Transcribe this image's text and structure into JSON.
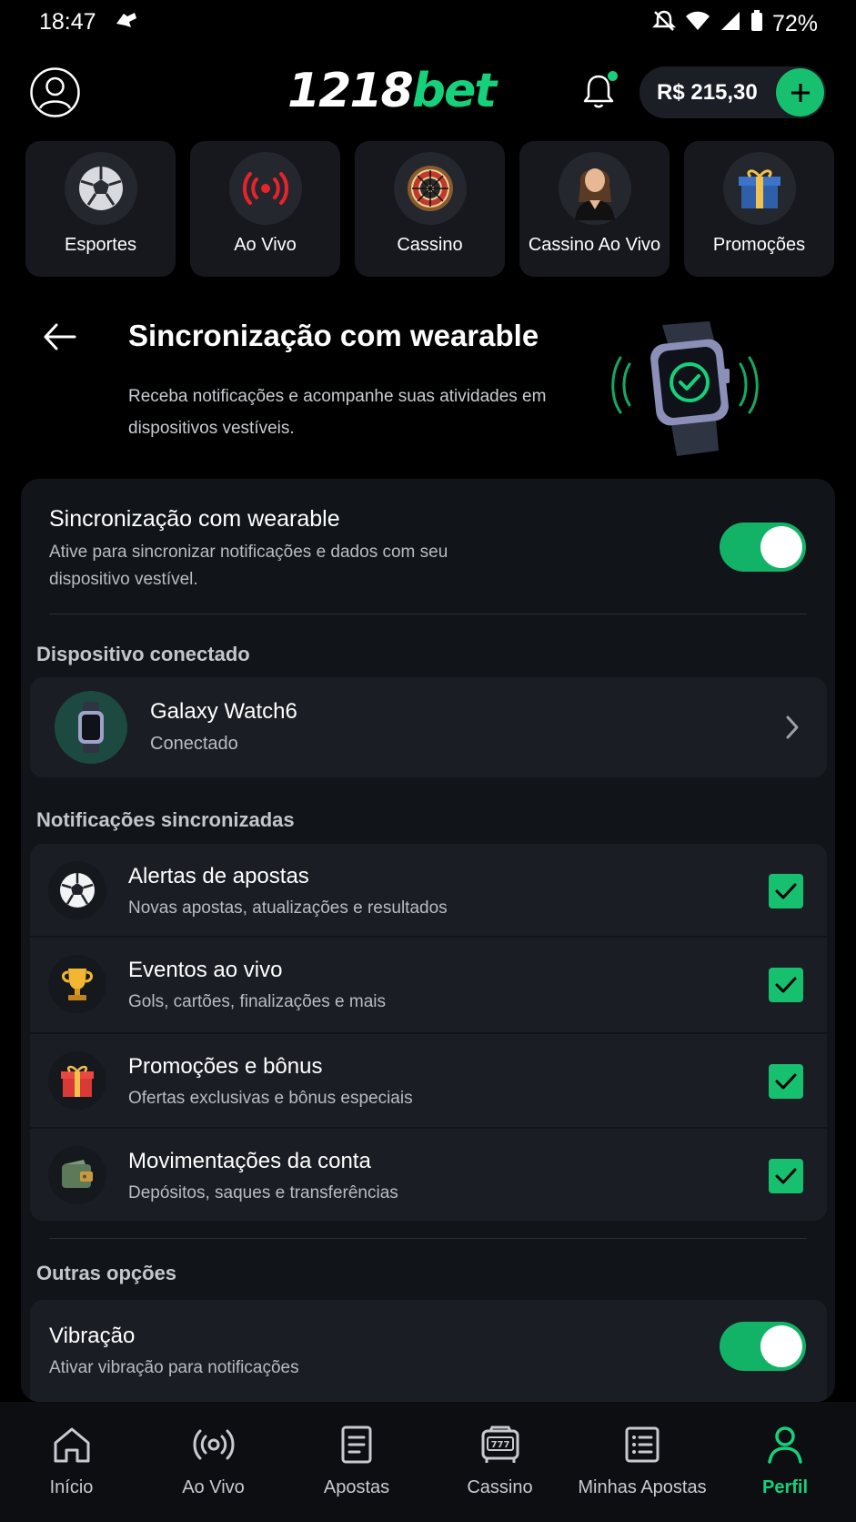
{
  "status_bar": {
    "time": "18:47",
    "battery": "72%"
  },
  "header": {
    "logo_part1": "1218",
    "logo_part2": "bet",
    "balance": "R$ 215,30"
  },
  "categories": [
    {
      "label": "Esportes",
      "icon": "soccer-ball-icon"
    },
    {
      "label": "Ao Vivo",
      "icon": "live-broadcast-icon"
    },
    {
      "label": "Cassino",
      "icon": "roulette-icon"
    },
    {
      "label": "Cassino Ao Vivo",
      "icon": "live-dealer-icon"
    },
    {
      "label": "Promoções",
      "icon": "gift-icon"
    }
  ],
  "page": {
    "title": "Sincronização com wearable",
    "subtitle": "Receba notificações e acompanhe suas atividades em dispositivos vestíveis."
  },
  "sync": {
    "title": "Sincronização com wearable",
    "description": "Ative para sincronizar notificações e dados com seu dispositivo vestível.",
    "enabled": true
  },
  "connected_device": {
    "section_label": "Dispositivo conectado",
    "name": "Galaxy Watch6",
    "status": "Conectado"
  },
  "notifications": {
    "section_label": "Notificações sincronizadas",
    "items": [
      {
        "title": "Alertas de apostas",
        "description": "Novas apostas, atualizações e resultados",
        "icon": "soccer-ball-icon",
        "checked": true
      },
      {
        "title": "Eventos ao vivo",
        "description": "Gols, cartões, finalizações e mais",
        "icon": "trophy-icon",
        "checked": true
      },
      {
        "title": "Promoções e bônus",
        "description": "Ofertas exclusivas e bônus especiais",
        "icon": "gift-icon",
        "checked": true
      },
      {
        "title": "Movimentações da conta",
        "description": "Depósitos, saques e transferências",
        "icon": "wallet-icon",
        "checked": true
      }
    ]
  },
  "other_options": {
    "section_label": "Outras opções",
    "vibration": {
      "title": "Vibração",
      "description": "Ativar vibração para notificações",
      "enabled": true
    }
  },
  "bottom_nav": [
    {
      "label": "Início",
      "icon": "home-icon"
    },
    {
      "label": "Ao Vivo",
      "icon": "live-icon"
    },
    {
      "label": "Apostas",
      "icon": "bets-icon"
    },
    {
      "label": "Cassino",
      "icon": "slot-machine-icon"
    },
    {
      "label": "Minhas Apostas",
      "icon": "my-bets-icon"
    },
    {
      "label": "Perfil",
      "icon": "profile-icon",
      "active": true
    }
  ],
  "colors": {
    "accent": "#16d17b",
    "background": "#000000",
    "card": "#111419",
    "row": "#1a1d23"
  }
}
